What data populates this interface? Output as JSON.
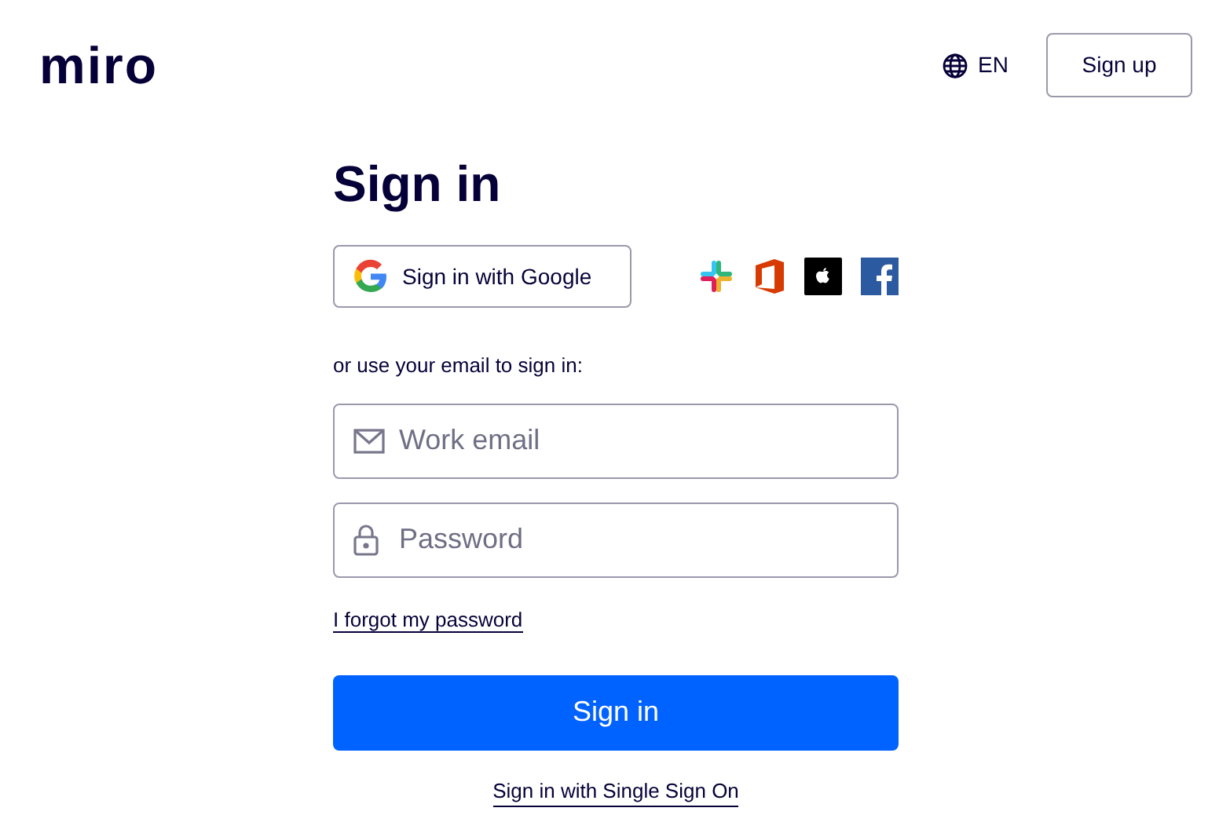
{
  "header": {
    "logo": "miro",
    "language": "EN",
    "signup_button": "Sign up"
  },
  "title": "Sign in",
  "google_button": "Sign in with Google",
  "social_providers": [
    {
      "kind": "slack"
    },
    {
      "kind": "office"
    },
    {
      "kind": "apple"
    },
    {
      "kind": "facebook"
    }
  ],
  "divider_text": "or use your email to sign in:",
  "fields": [
    {
      "kind": "email",
      "placeholder": "Work email"
    },
    {
      "kind": "password",
      "placeholder": "Password"
    }
  ],
  "forgot_link": "I forgot my password",
  "submit_button": "Sign in",
  "sso_link": "Sign in with Single Sign On"
}
